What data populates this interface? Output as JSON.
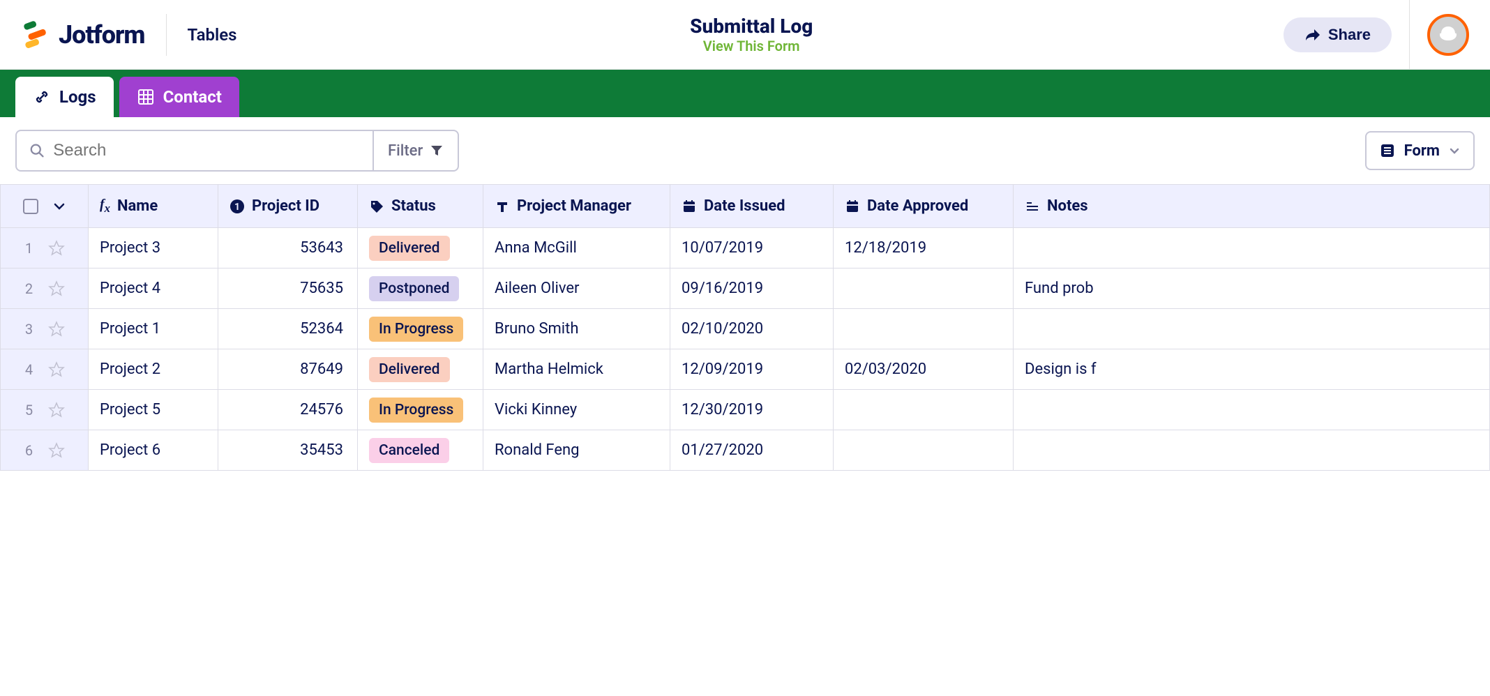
{
  "header": {
    "brand": "Jotform",
    "section": "Tables",
    "title": "Submittal Log",
    "view_link": "View This Form",
    "share_label": "Share"
  },
  "tabs": [
    {
      "label": "Logs",
      "active": true
    },
    {
      "label": "Contact",
      "active": false
    }
  ],
  "toolbar": {
    "search_placeholder": "Search",
    "filter_label": "Filter",
    "form_label": "Form"
  },
  "columns": [
    {
      "key": "name",
      "label": "Name",
      "icon": "fx"
    },
    {
      "key": "project_id",
      "label": "Project ID",
      "icon": "info"
    },
    {
      "key": "status",
      "label": "Status",
      "icon": "tag"
    },
    {
      "key": "project_manager",
      "label": "Project Manager",
      "icon": "text"
    },
    {
      "key": "date_issued",
      "label": "Date Issued",
      "icon": "calendar"
    },
    {
      "key": "date_approved",
      "label": "Date Approved",
      "icon": "calendar"
    },
    {
      "key": "notes",
      "label": "Notes",
      "icon": "notes"
    }
  ],
  "status_colors": {
    "Delivered": "s-delivered",
    "Postponed": "s-postponed",
    "In Progress": "s-inprogress",
    "Canceled": "s-canceled"
  },
  "rows": [
    {
      "n": "1",
      "name": "Project 3",
      "project_id": "53643",
      "status": "Delivered",
      "project_manager": "Anna McGill",
      "date_issued": "10/07/2019",
      "date_approved": "12/18/2019",
      "notes": ""
    },
    {
      "n": "2",
      "name": "Project 4",
      "project_id": "75635",
      "status": "Postponed",
      "project_manager": "Aileen Oliver",
      "date_issued": "09/16/2019",
      "date_approved": "",
      "notes": "Fund prob"
    },
    {
      "n": "3",
      "name": "Project 1",
      "project_id": "52364",
      "status": "In Progress",
      "project_manager": "Bruno Smith",
      "date_issued": "02/10/2020",
      "date_approved": "",
      "notes": ""
    },
    {
      "n": "4",
      "name": "Project 2",
      "project_id": "87649",
      "status": "Delivered",
      "project_manager": "Martha Helmick",
      "date_issued": "12/09/2019",
      "date_approved": "02/03/2020",
      "notes": "Design is f"
    },
    {
      "n": "5",
      "name": "Project 5",
      "project_id": "24576",
      "status": "In Progress",
      "project_manager": "Vicki Kinney",
      "date_issued": "12/30/2019",
      "date_approved": "",
      "notes": ""
    },
    {
      "n": "6",
      "name": "Project 6",
      "project_id": "35453",
      "status": "Canceled",
      "project_manager": "Ronald Feng",
      "date_issued": "01/27/2020",
      "date_approved": "",
      "notes": ""
    }
  ]
}
